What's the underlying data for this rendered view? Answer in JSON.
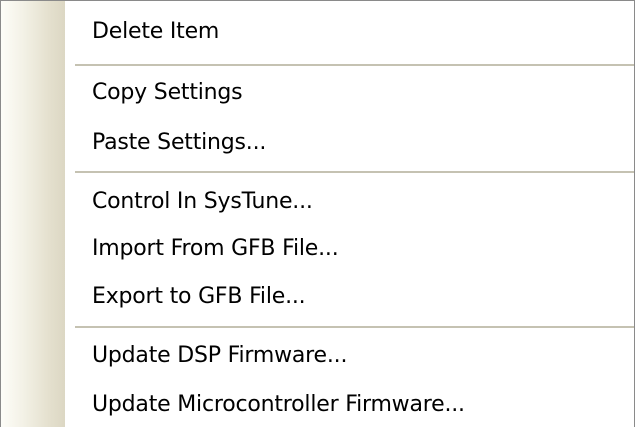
{
  "menu": {
    "items": [
      {
        "label": "Delete Item"
      },
      {
        "label": "Copy Settings"
      },
      {
        "label": "Paste Settings..."
      },
      {
        "label": "Control In SysTune..."
      },
      {
        "label": "Import From GFB File..."
      },
      {
        "label": "Export to GFB File..."
      },
      {
        "label": "Update DSP Firmware..."
      },
      {
        "label": "Update Microcontroller Firmware..."
      }
    ]
  }
}
